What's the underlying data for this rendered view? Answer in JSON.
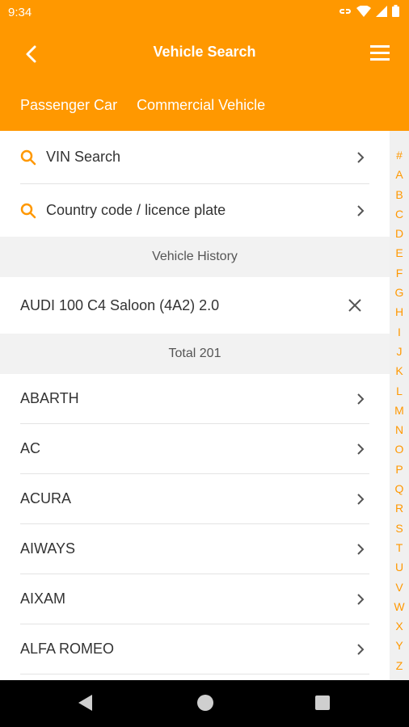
{
  "status": {
    "time": "9:34"
  },
  "header": {
    "title": "Vehicle Search",
    "tabs": [
      "Passenger Car",
      "Commercial Vehicle"
    ]
  },
  "search": {
    "vin_label": "VIN Search",
    "plate_label": "Country code / licence plate"
  },
  "history": {
    "header": "Vehicle History",
    "item": "AUDI 100 C4 Saloon (4A2) 2.0"
  },
  "brands": {
    "total_label": "Total 201",
    "items": [
      "ABARTH",
      "AC",
      "ACURA",
      "AIWAYS",
      "AIXAM",
      "ALFA ROMEO"
    ]
  },
  "index_letters": [
    "#",
    "A",
    "B",
    "C",
    "D",
    "E",
    "F",
    "G",
    "H",
    "I",
    "J",
    "K",
    "L",
    "M",
    "N",
    "O",
    "P",
    "Q",
    "R",
    "S",
    "T",
    "U",
    "V",
    "W",
    "X",
    "Y",
    "Z"
  ],
  "colors": {
    "accent": "#ff9800",
    "text": "#333333",
    "section_bg": "#f2f2f2"
  }
}
